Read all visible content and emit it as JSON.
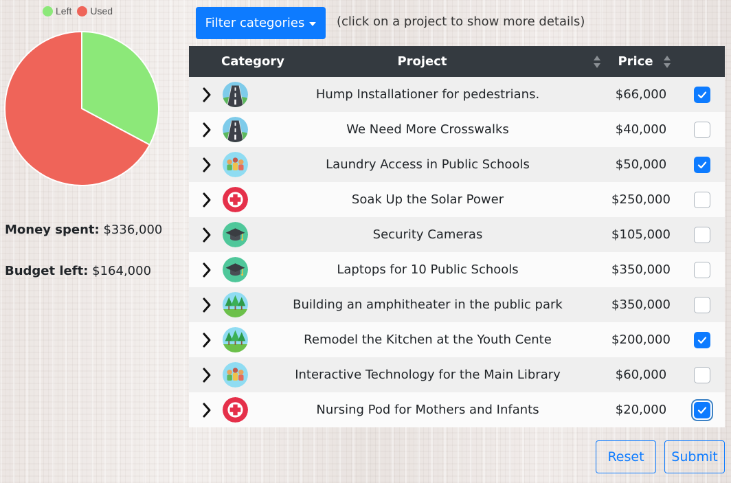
{
  "colors": {
    "left": "#8ce879",
    "used": "#ef6459",
    "primary": "#0d7bff",
    "header_bg": "#343a40"
  },
  "chart_data": {
    "type": "pie",
    "legend": [
      "Left",
      "Used"
    ],
    "values": [
      164000,
      336000
    ],
    "colors": [
      "#8ce879",
      "#ef6459"
    ],
    "legend_position": "top"
  },
  "stats": {
    "spent_label": "Money spent:",
    "spent_value": "$336,000",
    "left_label": "Budget left:",
    "left_value": "$164,000"
  },
  "filter": {
    "label": "Filter categories"
  },
  "hint": "(click on a project to show more details)",
  "table": {
    "headers": {
      "category": "Category",
      "project": "Project",
      "price": "Price"
    },
    "rows": [
      {
        "icon": "road-icon",
        "project": "Hump Installationer for pedestrians.",
        "price": "$66,000",
        "checked": true
      },
      {
        "icon": "road-icon",
        "project": "We Need More Crosswalks",
        "price": "$40,000",
        "checked": false
      },
      {
        "icon": "community-icon",
        "project": "Laundry Access in Public Schools",
        "price": "$50,000",
        "checked": true
      },
      {
        "icon": "health-cross-icon",
        "project": "Soak Up the Solar Power",
        "price": "$250,000",
        "checked": false
      },
      {
        "icon": "graduation-cap-icon",
        "project": "Security Cameras",
        "price": "$105,000",
        "checked": false
      },
      {
        "icon": "graduation-cap-icon",
        "project": "Laptops for 10 Public Schools",
        "price": "$350,000",
        "checked": false
      },
      {
        "icon": "park-trees-icon",
        "project": "Building an amphitheater in the public park",
        "price": "$350,000",
        "checked": false
      },
      {
        "icon": "park-trees-icon",
        "project": "Remodel the Kitchen at the Youth Cente",
        "price": "$200,000",
        "checked": true
      },
      {
        "icon": "community-icon",
        "project": "Interactive Technology for the Main Library",
        "price": "$60,000",
        "checked": false
      },
      {
        "icon": "health-cross-icon",
        "project": "Nursing Pod for Mothers and Infants",
        "price": "$20,000",
        "checked": true,
        "focused": true
      }
    ]
  },
  "buttons": {
    "reset": "Reset",
    "submit": "Submit"
  }
}
